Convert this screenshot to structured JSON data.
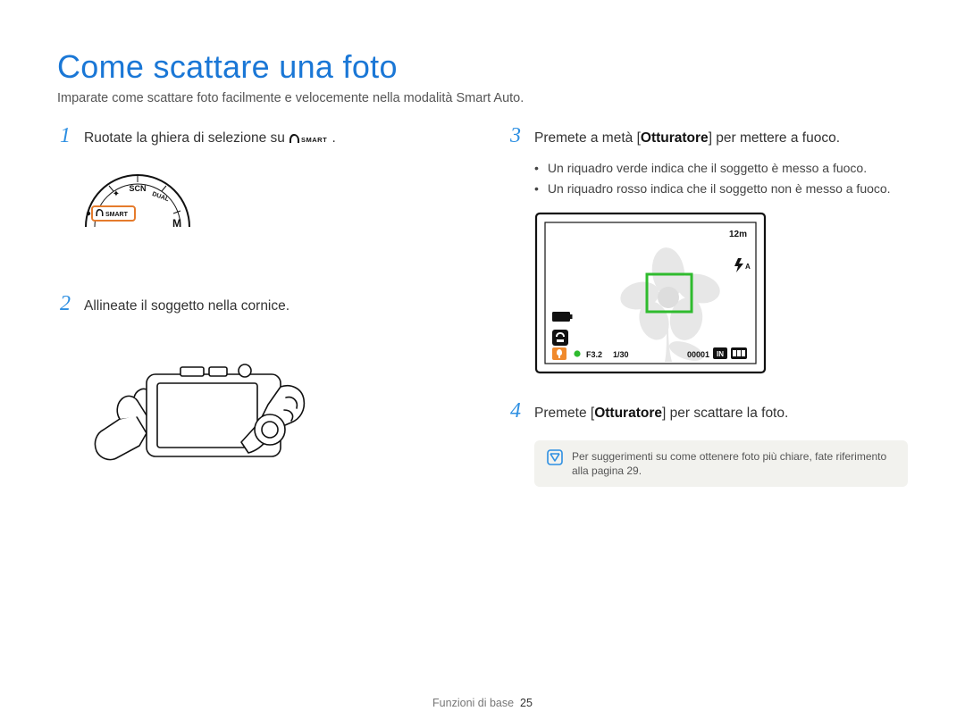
{
  "title": "Come scattare una foto",
  "subtitle": "Imparate come scattare foto facilmente e velocemente nella modalità Smart Auto.",
  "steps": {
    "s1": {
      "num": "1",
      "text_before": "Ruotate la ghiera di selezione su ",
      "icon_label": "SMART",
      "text_after": "."
    },
    "s2": {
      "num": "2",
      "text": "Allineate il soggetto nella cornice."
    },
    "s3": {
      "num": "3",
      "text_before": "Premete a metà [",
      "strong": "Otturatore",
      "text_after": "] per mettere a fuoco."
    },
    "s3_bullets": [
      "Un riquadro verde indica che il soggetto è messo a fuoco.",
      "Un riquadro rosso indica che il soggetto non è messo a fuoco."
    ],
    "s4": {
      "num": "4",
      "text_before": "Premete [",
      "strong": "Otturatore",
      "text_after": "] per scattare la foto."
    }
  },
  "note": "Per suggerimenti su come ottenere foto più chiare, fate riferimento alla pagina 29.",
  "screen": {
    "resolution": "12m",
    "flash_mode": "A",
    "aperture": "F3.2",
    "shutter": "1/30",
    "shots_remaining": "00001"
  },
  "footer": {
    "section": "Funzioni di base",
    "page": "25"
  }
}
